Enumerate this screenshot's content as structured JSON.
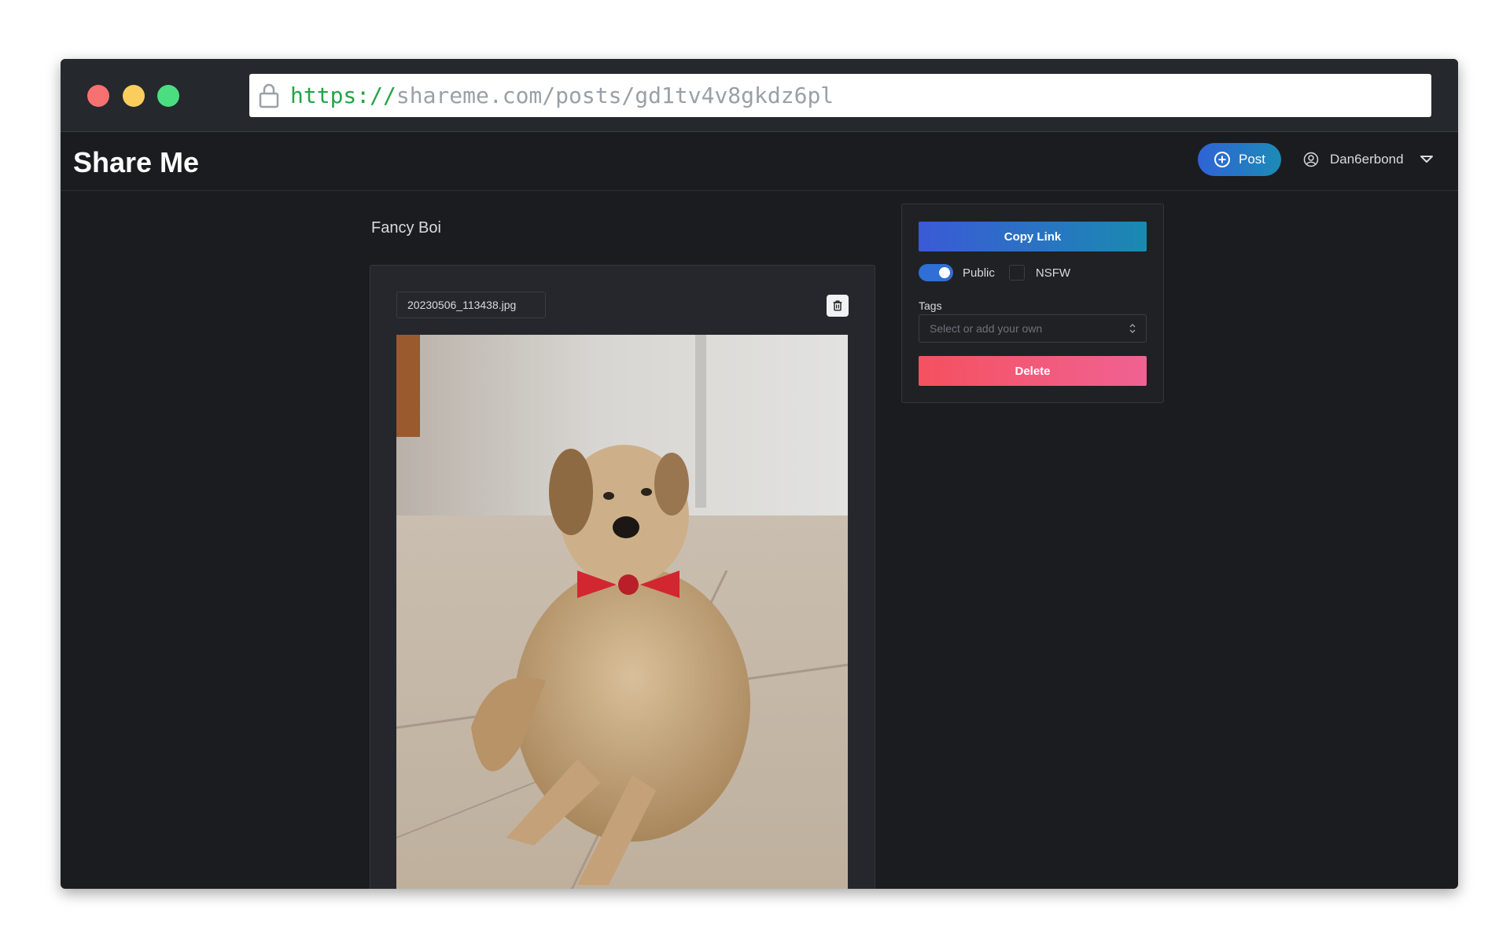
{
  "browser": {
    "url_scheme": "https://",
    "url_rest": "shareme.com/posts/gd1tv4v8gkdz6pl"
  },
  "app": {
    "logo": "Share Me",
    "post_label": "Post",
    "username": "Dan6erbond"
  },
  "post": {
    "title": "Fancy Boi",
    "filename": "20230506_113438.jpg"
  },
  "side_panel": {
    "copy_link_label": "Copy Link",
    "public_label": "Public",
    "public_enabled": true,
    "nsfw_label": "NSFW",
    "nsfw_checked": false,
    "tags_label": "Tags",
    "tags_placeholder": "Select or add your own",
    "delete_label": "Delete"
  },
  "colors": {
    "background": "#1b1c20",
    "accent_blue": "#2f63d6",
    "delete_red": "#f5515f"
  }
}
